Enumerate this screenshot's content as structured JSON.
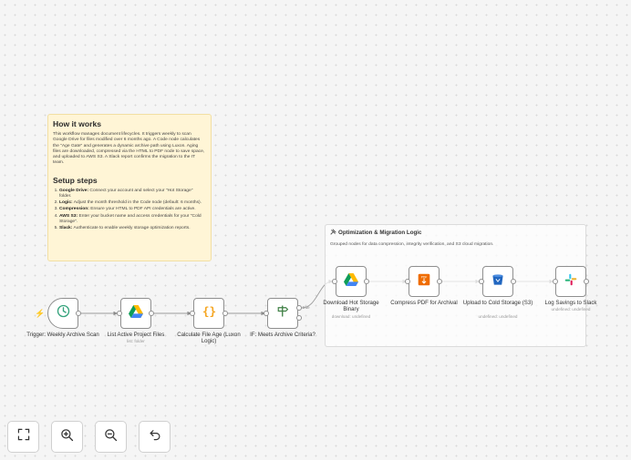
{
  "sticky": {
    "title": "How it works",
    "body": "This workflow manages document lifecycles. It triggers weekly to scan Google Drive for files modified over 6 months ago. A Code node calculates the \"Age Gate\" and generates a dynamic archive path using Luxon. Aging files are downloaded, compressed via the HTML to PDF node to save space, and uploaded to AWS S3. A Slack report confirms the migration to the IT team.",
    "setup_title": "Setup steps",
    "steps": [
      {
        "bold": "Google Drive:",
        "text": " Connect your account and select your \"Hot Storage\" folder."
      },
      {
        "bold": "Logic:",
        "text": " Adjust the month threshold in the Code node (default: 6 months)."
      },
      {
        "bold": "Compression:",
        "text": " Ensure your HTML to PDF API credentials are active."
      },
      {
        "bold": "AWS S3:",
        "text": " Enter your bucket name and access credentials for your \"Cold Storage\"."
      },
      {
        "bold": "Slack:",
        "text": " Authenticate to enable weekly storage optimization reports."
      }
    ]
  },
  "group": {
    "title": "Optimization & Migration Logic",
    "description": "Grouped nodes for data compression, integrity verification, and S3 cloud migration."
  },
  "nodes": {
    "trigger": {
      "label": "Trigger: Weekly Archive Scan",
      "icon": "clock-icon",
      "color": "#35a37c"
    },
    "list_files": {
      "label": "List Active Project Files",
      "sub": "list: folder",
      "icon": "google-drive-icon"
    },
    "calc_age": {
      "label": "Calculate File Age (Luxon Logic)",
      "icon": "code-braces-icon",
      "color": "#f5a623"
    },
    "if_node": {
      "label": "IF: Meets Archive Criteria?",
      "true_label": "true",
      "icon": "signpost-icon",
      "color": "#408046"
    },
    "download": {
      "label": "Download Hot Storage Binary",
      "sub": "download: undefined",
      "icon": "google-drive-icon"
    },
    "compress": {
      "label": "Compress PDF for Archival",
      "icon": "pdf-icon",
      "color": "#ef6c00"
    },
    "upload": {
      "label": "Upload to Cold Storage (S3)",
      "sub": "undefined: undefined",
      "icon": "s3-bucket-icon",
      "color": "#2166c0"
    },
    "slack": {
      "label": "Log Savings to Slack",
      "sub": "undefined: undefined",
      "icon": "slack-icon"
    }
  },
  "controls": {
    "fit": "fit-view-icon",
    "zoom_in": "zoom-in-icon",
    "zoom_out": "zoom-out-icon",
    "reset": "undo-icon"
  }
}
